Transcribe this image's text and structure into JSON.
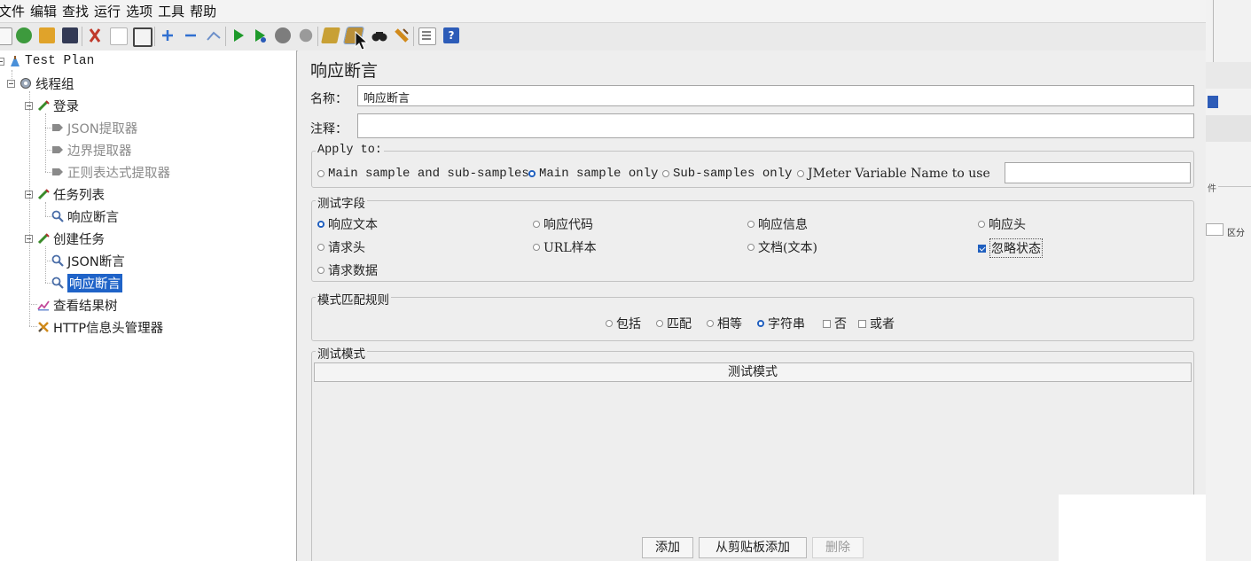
{
  "menu": [
    "文件",
    "编辑",
    "查找",
    "运行",
    "选项",
    "工具",
    "帮助"
  ],
  "toolbar_icons": [
    "new-icon",
    "templates-icon",
    "open-icon",
    "save-icon",
    "cut-icon",
    "copy-icon",
    "paste-icon",
    "expand-icon",
    "collapse-icon",
    "toggle-icon",
    "start-icon",
    "start-no-pause-icon",
    "stop-icon",
    "shutdown-icon",
    "clear-icon",
    "clear-all-icon",
    "search-icon",
    "reset-search-icon",
    "function-helper-icon",
    "help-icon"
  ],
  "tree": {
    "nodes": [
      {
        "label": "Test Plan",
        "icon": "test-plan-icon"
      },
      {
        "label": "线程组",
        "icon": "thread-group-icon"
      },
      {
        "label": "登录",
        "icon": "sampler-icon"
      },
      {
        "label": "JSON提取器",
        "icon": "extractor-icon"
      },
      {
        "label": "边界提取器",
        "icon": "extractor-icon"
      },
      {
        "label": "正则表达式提取器",
        "icon": "extractor-icon"
      },
      {
        "label": "任务列表",
        "icon": "sampler-icon"
      },
      {
        "label": "响应断言",
        "icon": "assertion-icon"
      },
      {
        "label": "创建任务",
        "icon": "sampler-icon"
      },
      {
        "label": "JSON断言",
        "icon": "assertion-icon"
      },
      {
        "label": "响应断言",
        "icon": "assertion-icon"
      },
      {
        "label": "查看结果树",
        "icon": "listener-icon"
      },
      {
        "label": "HTTP信息头管理器",
        "icon": "config-icon"
      }
    ]
  },
  "panel": {
    "title": "响应断言",
    "name_label": "名称：",
    "name_value": "响应断言",
    "comment_label": "注释：",
    "comment_value": "",
    "apply_to": {
      "title": "Apply to:",
      "options": [
        "Main sample and sub-samples",
        "Main sample only",
        "Sub-samples only",
        "JMeter Variable Name to use"
      ],
      "selected": "Main sample only"
    },
    "test_field": {
      "title": "测试字段",
      "options": [
        "响应文本",
        "响应代码",
        "响应信息",
        "响应头",
        "请求头",
        "URL样本",
        "文档(文本)",
        "请求数据"
      ],
      "selected": "响应文本",
      "ignore_status_label": "忽略状态",
      "ignore_status_checked": true
    },
    "pattern_rules": {
      "title": "模式匹配规则",
      "radios": [
        "包括",
        "匹配",
        "相等",
        "字符串"
      ],
      "selected": "字符串",
      "checks": [
        "否",
        "或者"
      ]
    },
    "test_patterns": {
      "title": "测试模式",
      "column_header": "测试模式"
    },
    "buttons": {
      "add": "添加",
      "add_clipboard": "从剪贴板添加",
      "delete": "删除"
    }
  },
  "background_window": {
    "label_fragment": "件",
    "checkbox_fragment": "区分"
  },
  "colors": {
    "selection": "#1f63c8",
    "radio_on": "#1f5fbf",
    "panel_bg": "#eeeeee"
  }
}
